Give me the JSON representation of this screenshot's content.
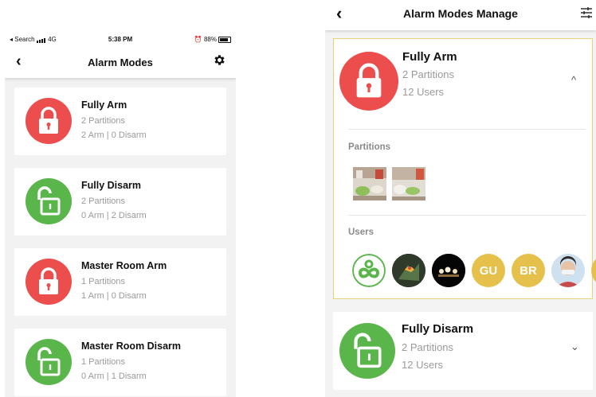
{
  "colors": {
    "arm_red": "#ec4d4d",
    "disarm_green": "#5ab54b",
    "highlight_border": "#e7d27a",
    "initials_badge": "#e5c04a"
  },
  "left_screen": {
    "status_bar": {
      "carrier": "◂ Search",
      "network": "4G",
      "time": "5:38 PM",
      "battery": "88%"
    },
    "nav": {
      "back_icon": "chevron-left-icon",
      "title": "Alarm Modes",
      "settings_icon": "gear-icon"
    },
    "modes": [
      {
        "name": "Fully Arm",
        "partitions": "2 Partitions",
        "counts": "2 Arm | 0 Disarm",
        "icon": "lock-closed-icon",
        "color": "red"
      },
      {
        "name": "Fully Disarm",
        "partitions": "2 Partitions",
        "counts": "0 Arm | 2 Disarm",
        "icon": "lock-open-icon",
        "color": "green"
      },
      {
        "name": "Master Room Arm",
        "partitions": "1 Partitions",
        "counts": "1 Arm | 0 Disarm",
        "icon": "lock-closed-icon",
        "color": "red"
      },
      {
        "name": "Master Room Disarm",
        "partitions": "1 Partitions",
        "counts": "0 Arm | 1 Disarm",
        "icon": "lock-open-icon",
        "color": "green"
      }
    ]
  },
  "right_screen": {
    "nav": {
      "back_icon": "chevron-left-icon",
      "title": "Alarm Modes Manage",
      "filter_icon": "sliders-icon"
    },
    "expanded_mode": {
      "name": "Fully Arm",
      "partitions": "2 Partitions",
      "users": "12 Users",
      "chevron": "^",
      "partitions_heading": "Partitions",
      "users_heading": "Users",
      "user_initials": [
        "GU",
        "BR"
      ]
    },
    "collapsed_mode": {
      "name": "Fully Disarm",
      "partitions": "2 Partitions",
      "users": "12 Users",
      "chevron": "⌄"
    }
  }
}
